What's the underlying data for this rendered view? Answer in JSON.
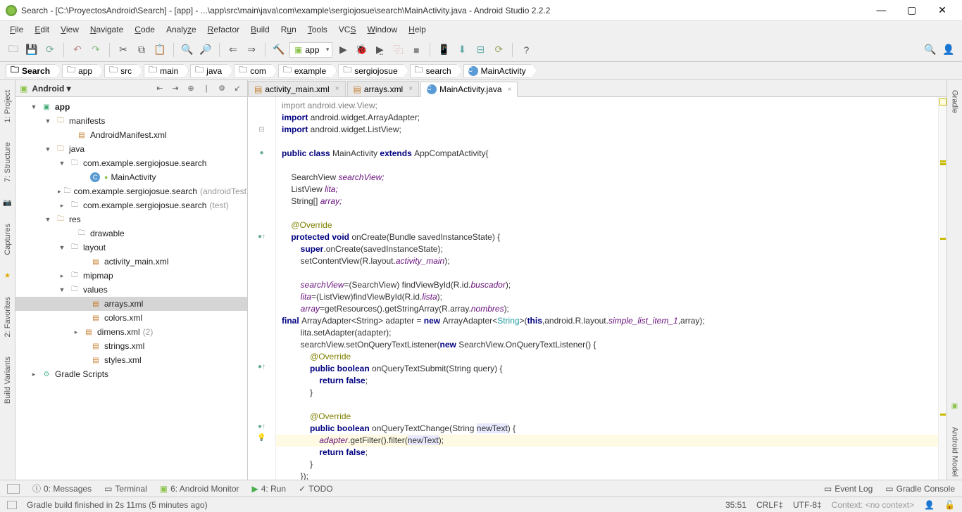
{
  "title": "Search - [C:\\ProyectosAndroid\\Search] - [app] - ...\\app\\src\\main\\java\\com\\example\\sergiojosue\\search\\MainActivity.java - Android Studio 2.2.2",
  "menu": [
    "File",
    "Edit",
    "View",
    "Navigate",
    "Code",
    "Analyze",
    "Refactor",
    "Build",
    "Run",
    "Tools",
    "VCS",
    "Window",
    "Help"
  ],
  "run_config": "app",
  "breadcrumbs": [
    "Search",
    "app",
    "src",
    "main",
    "java",
    "com",
    "example",
    "sergiojosue",
    "search",
    "MainActivity"
  ],
  "panel_title": "Android",
  "left_tabs": [
    "1: Project",
    "7: Structure",
    "Captures",
    "2: Favorites",
    "Build Variants"
  ],
  "right_tabs": [
    "Gradle",
    "Android Model"
  ],
  "tree": {
    "app": "app",
    "manifests": "manifests",
    "android_manifest": "AndroidManifest.xml",
    "java": "java",
    "pkg_main": "com.example.sergiojosue.search",
    "main_activity": "MainActivity",
    "pkg_test1": "com.example.sergiojosue.search",
    "pkg_test1_suffix": "(androidTest)",
    "pkg_test2": "com.example.sergiojosue.search",
    "pkg_test2_suffix": "(test)",
    "res": "res",
    "drawable": "drawable",
    "layout": "layout",
    "activity_main_xml": "activity_main.xml",
    "mipmap": "mipmap",
    "values": "values",
    "arrays_xml": "arrays.xml",
    "colors_xml": "colors.xml",
    "dimens_xml": "dimens.xml",
    "dimens_suffix": "(2)",
    "strings_xml": "strings.xml",
    "styles_xml": "styles.xml",
    "gradle_scripts": "Gradle Scripts"
  },
  "tabs": {
    "t1": "activity_main.xml",
    "t2": "arrays.xml",
    "t3": "MainActivity.java"
  },
  "code": {
    "l1": "import android.view.View;",
    "l2": "import android.widget.ArrayAdapter;",
    "l3": "import android.widget.ListView;",
    "l4": "",
    "l5_pre": "public class ",
    "l5_name": "MainActivity ",
    "l5_ext": "extends ",
    "l5_sup": "AppCompatActivity{",
    "l6": "",
    "l7a": "    SearchView ",
    "l7b": "searchView;",
    "l8a": "    ListView ",
    "l8b": "lita;",
    "l9a": "    String[] ",
    "l9b": "array;",
    "l10": "",
    "l11": "    @Override",
    "l12a": "    protected void ",
    "l12b": "onCreate(Bundle savedInstanceState) {",
    "l13a": "        super",
    "l13b": ".onCreate(savedInstanceState);",
    "l14a": "        setContentView(R.layout.",
    "l14b": "activity_main",
    "l14c": ");",
    "l15": "",
    "l16a": "        searchView",
    "l16b": "=(SearchView) findViewById(R.id.",
    "l16c": "buscador",
    "l16d": ");",
    "l17a": "        lita",
    "l17b": "=(ListView)findViewById(R.id.",
    "l17c": "lista",
    "l17d": ");",
    "l18a": "        array",
    "l18b": "=getResources().getStringArray(R.array.",
    "l18c": "nombres",
    "l18d": ");",
    "l19a": "final ",
    "l19b": "ArrayAdapter<String> adapter = ",
    "l19c": "new ",
    "l19d": "ArrayAdapter<",
    "l19e": "String",
    "l19f": ">(",
    "l19g": "this",
    "l19h": ",android.R.layout.",
    "l19i": "simple_list_item_1",
    "l19j": ",array);",
    "l20": "        lita.setAdapter(adapter);",
    "l21a": "        searchView.setOnQueryTextListener(",
    "l21b": "new ",
    "l21c": "SearchView.OnQueryTextListener() {",
    "l22": "            @Override",
    "l23a": "            public boolean ",
    "l23b": "onQueryTextSubmit(String query) {",
    "l24a": "                return false",
    "l24b": ";",
    "l25": "            }",
    "l26": "",
    "l27": "            @Override",
    "l28a": "            public boolean ",
    "l28b": "onQueryTextChange(String ",
    "l28c": "newText",
    "l28d": ") {",
    "l29a": "                adapter",
    "l29b": ".getFilter().filter(",
    "l29c": "newText",
    "l29d": ");",
    "l30a": "                return false",
    "l30b": ";",
    "l31": "            }",
    "l32": "        });"
  },
  "bottom_tabs": {
    "messages": "0: Messages",
    "terminal": "Terminal",
    "android_monitor": "6: Android Monitor",
    "run": "4: Run",
    "todo": "TODO",
    "event_log": "Event Log",
    "gradle_console": "Gradle Console"
  },
  "status": {
    "msg": "Gradle build finished in 2s 11ms (5 minutes ago)",
    "pos": "35:51",
    "lineend": "CRLF‡",
    "encoding": "UTF-8‡",
    "context": "Context: <no context>"
  }
}
